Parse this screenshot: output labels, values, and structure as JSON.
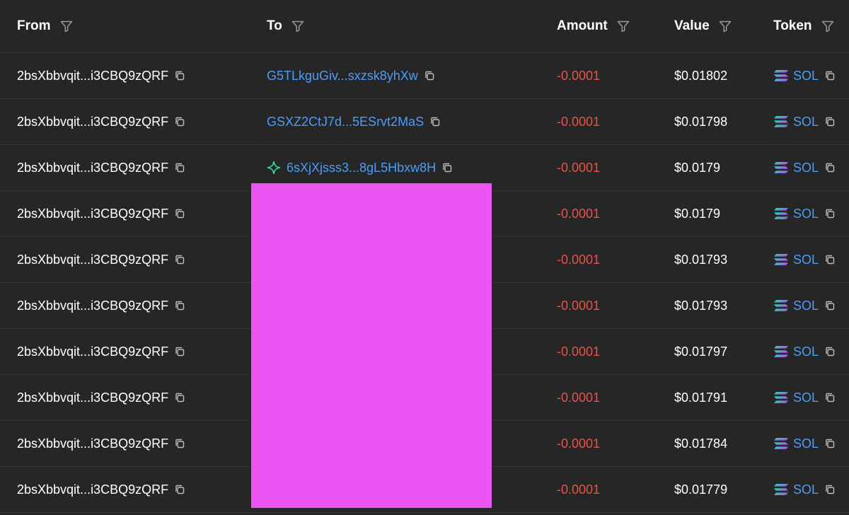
{
  "header": {
    "from": "From",
    "to": "To",
    "amount": "Amount",
    "value": "Value",
    "token": "Token"
  },
  "rows": [
    {
      "from": "2bsXbbvqit...i3CBQ9zQRF",
      "to": "G5TLkguGiv...sxzsk8yhXw",
      "amount": "-0.0001",
      "value": "$0.01802",
      "token": "SOL",
      "to_flag": false
    },
    {
      "from": "2bsXbbvqit...i3CBQ9zQRF",
      "to": "GSXZ2CtJ7d...5ESrvt2MaS",
      "amount": "-0.0001",
      "value": "$0.01798",
      "token": "SOL",
      "to_flag": false
    },
    {
      "from": "2bsXbbvqit...i3CBQ9zQRF",
      "to": "6sXjXjsss3...8gL5Hbxw8H",
      "amount": "-0.0001",
      "value": "$0.0179",
      "token": "SOL",
      "to_flag": true
    },
    {
      "from": "2bsXbbvqit...i3CBQ9zQRF",
      "to": "",
      "amount": "-0.0001",
      "value": "$0.0179",
      "token": "SOL",
      "to_flag": false
    },
    {
      "from": "2bsXbbvqit...i3CBQ9zQRF",
      "to": "",
      "amount": "-0.0001",
      "value": "$0.01793",
      "token": "SOL",
      "to_flag": false
    },
    {
      "from": "2bsXbbvqit...i3CBQ9zQRF",
      "to": "",
      "amount": "-0.0001",
      "value": "$0.01793",
      "token": "SOL",
      "to_flag": false
    },
    {
      "from": "2bsXbbvqit...i3CBQ9zQRF",
      "to": "",
      "amount": "-0.0001",
      "value": "$0.01797",
      "token": "SOL",
      "to_flag": false
    },
    {
      "from": "2bsXbbvqit...i3CBQ9zQRF",
      "to": "",
      "amount": "-0.0001",
      "value": "$0.01791",
      "token": "SOL",
      "to_flag": false
    },
    {
      "from": "2bsXbbvqit...i3CBQ9zQRF",
      "to": "",
      "amount": "-0.0001",
      "value": "$0.01784",
      "token": "SOL",
      "to_flag": false
    },
    {
      "from": "2bsXbbvqit...i3CBQ9zQRF",
      "to": "",
      "amount": "-0.0001",
      "value": "$0.01779",
      "token": "SOL",
      "to_flag": false
    }
  ],
  "icons": {
    "filter": "filter-icon",
    "copy": "copy-icon",
    "sparkle": "sparkle-icon",
    "token_logo": "solana-logo-icon"
  },
  "colors": {
    "background": "#262626",
    "link": "#4d9df8",
    "negative": "#e5534b",
    "redaction": "#ea55f4"
  }
}
